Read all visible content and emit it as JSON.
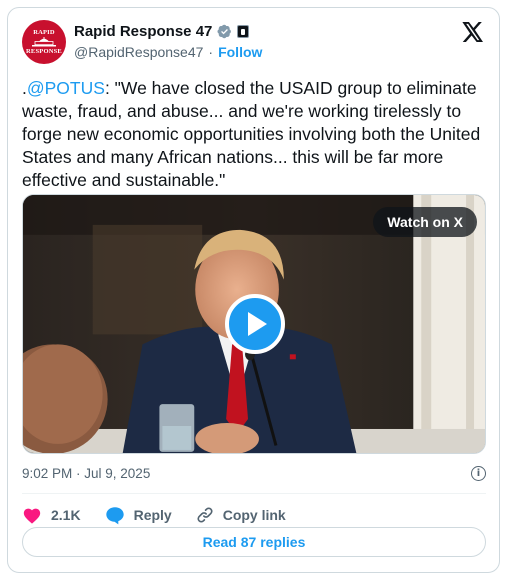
{
  "author": {
    "avatar_text_top": "RAPID",
    "avatar_text_bottom": "RESPONSE",
    "display_name": "Rapid Response 47",
    "handle": "@RapidResponse47",
    "separator": "·",
    "follow_label": "Follow"
  },
  "tweet": {
    "prefix": ".",
    "mention": "@POTUS",
    "body": ": \"We have closed the USAID group to eliminate waste, fraud, and abuse... and we're working tirelessly to forge new economic opportunities involving both the United States and many African nations... this will be far more effective and sustainable.\""
  },
  "media": {
    "watch_label": "Watch on X"
  },
  "meta": {
    "timestamp": "9:02 PM · Jul 9, 2025",
    "info_glyph": "i"
  },
  "actions": {
    "like_count": "2.1K",
    "reply_label": "Reply",
    "copy_link_label": "Copy link"
  },
  "read_replies_label": "Read 87 replies",
  "colors": {
    "accent": "#1d9bf0",
    "like": "#f91880",
    "brand_red": "#c8102e"
  }
}
